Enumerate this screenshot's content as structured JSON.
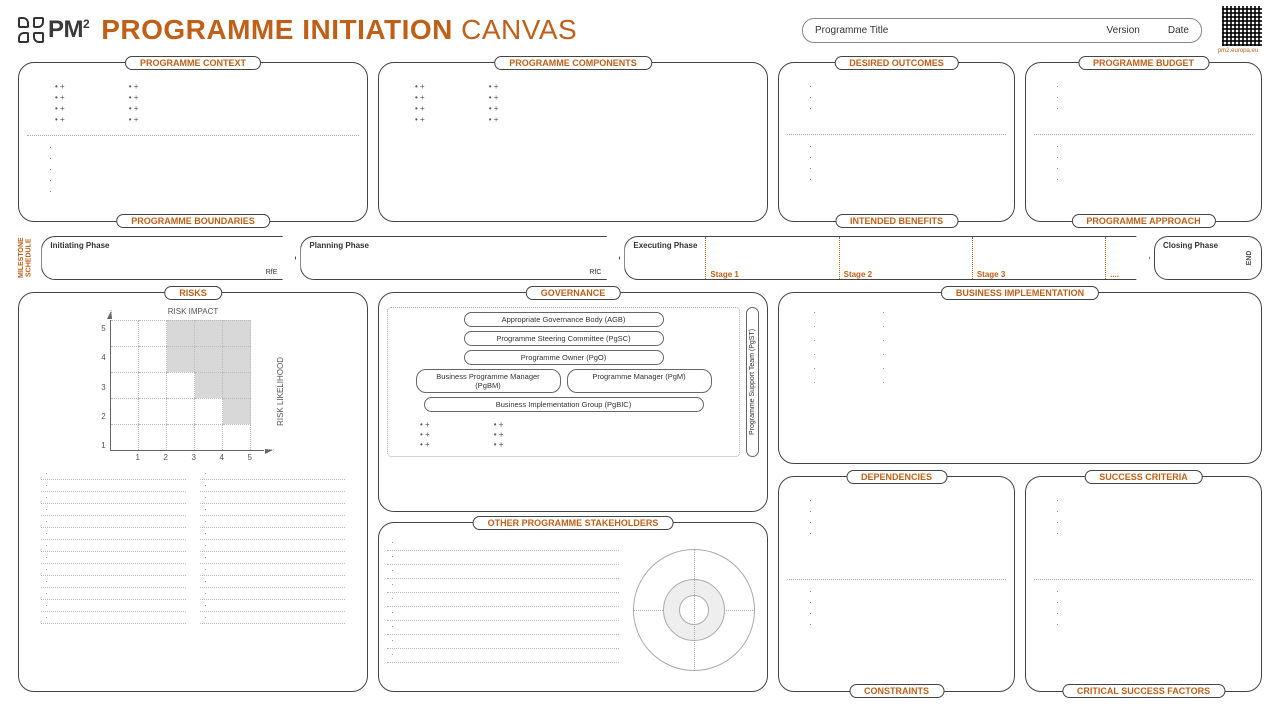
{
  "header": {
    "logo": "PM²",
    "title_strong": "PROGRAMME INITIATION",
    "title_light": "CANVAS",
    "meta_programme": "Programme Title",
    "meta_version": "Version",
    "meta_date": "Date",
    "qr_link": "pm2.europa.eu"
  },
  "row1": {
    "context_title": "PROGRAMME CONTEXT",
    "boundaries_title": "PROGRAMME BOUNDARIES",
    "components_title": "PROGRAMME COMPONENTS",
    "outcomes_title": "DESIRED OUTCOMES",
    "benefits_title": "INTENDED BENEFITS",
    "budget_title": "PROGRAMME BUDGET",
    "approach_title": "PROGRAMME APPROACH"
  },
  "milestone": {
    "label": "MILESTONE SCHEDULE",
    "phase1": "Initiating Phase",
    "tag1": "RfE",
    "phase2": "Planning Phase",
    "tag2": "RfC",
    "phase3": "Executing Phase",
    "stage1": "Stage 1",
    "stage2": "Stage 2",
    "stage3": "Stage 3",
    "stage_dots": "....",
    "phase4": "Closing Phase",
    "end": "END"
  },
  "risks": {
    "title": "RISKS",
    "impact": "RISK IMPACT",
    "likelihood": "RISK LIKELIHOOD",
    "axis": [
      "1",
      "2",
      "3",
      "4",
      "5"
    ]
  },
  "gov": {
    "title": "GOVERNANCE",
    "agb": "Appropriate Governance Body (AGB)",
    "pgsc": "Programme Steering Committee (PgSC)",
    "pgo": "Programme Owner (PgO)",
    "pgbm": "Business Programme Manager (PgBM)",
    "pgm": "Programme Manager (PgM)",
    "pgbic": "Business Implementation Group (PgBIC)",
    "pgst": "Programme Support Team (PgST)"
  },
  "stake": {
    "title": "OTHER PROGRAMME STAKEHOLDERS"
  },
  "right": {
    "biz": "BUSINESS IMPLEMENTATION",
    "dep": "DEPENDENCIES",
    "succ": "SUCCESS CRITERIA",
    "cons": "CONSTRAINTS",
    "csf": "CRITICAL SUCCESS FACTORS"
  }
}
